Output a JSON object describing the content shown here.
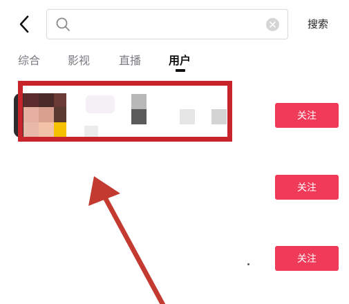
{
  "search": {
    "value": "",
    "placeholder": "",
    "button_label": "搜索"
  },
  "tabs": [
    {
      "label": "综合",
      "active": false
    },
    {
      "label": "影视",
      "active": false
    },
    {
      "label": "直播",
      "active": false
    },
    {
      "label": "用户",
      "active": true
    }
  ],
  "results": [
    {
      "follow_label": "关注"
    },
    {
      "follow_label": "关注"
    },
    {
      "follow_label": "关注"
    }
  ],
  "colors": {
    "accent": "#ef3a5a",
    "highlight": "#c8242b",
    "arrow": "#c33a30"
  },
  "icons": {
    "back": "chevron-left-icon",
    "search": "search-icon",
    "clear": "clear-icon"
  }
}
